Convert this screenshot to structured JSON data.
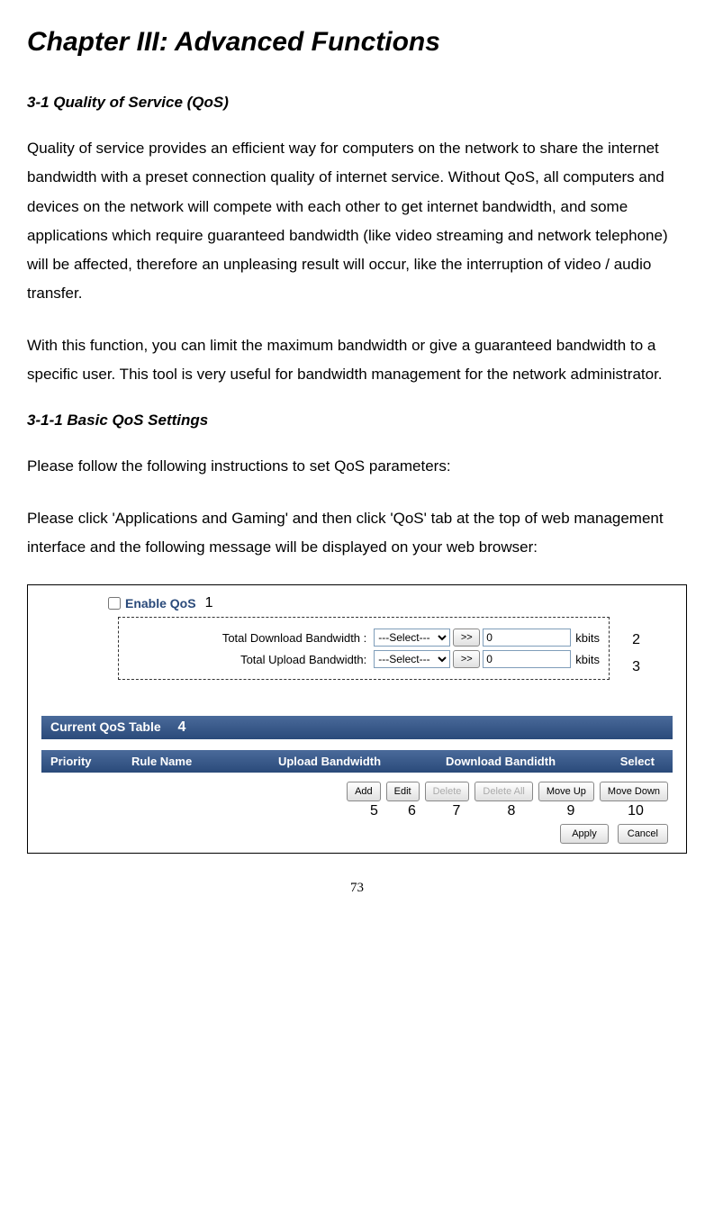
{
  "page": {
    "chapterTitle": "Chapter III: Advanced Functions",
    "section1": "3-1 Quality of Service (QoS)",
    "para1": "Quality of service provides an efficient way for computers on the network to share the internet bandwidth with a preset connection quality of internet service. Without QoS, all computers and devices on the network will compete with each other to get internet bandwidth, and some applications which require guaranteed bandwidth (like video streaming and network telephone) will be affected, therefore an unpleasing result will occur, like the interruption of video / audio transfer.",
    "para2": "With this function, you can limit the maximum bandwidth or give a guaranteed bandwidth to a specific user.    This tool is very useful for bandwidth management for the network administrator.",
    "section1_1": "3-1-1 Basic QoS Settings",
    "para3": "Please follow the following instructions to set QoS parameters:",
    "para4": "Please click 'Applications and Gaming' and then click 'QoS' tab at the top of web management interface and the following message will be displayed on your web browser:",
    "pageNumber": "73"
  },
  "qos": {
    "enableLabel": "Enable QoS",
    "callout1": "1",
    "downloadLabel": "Total Download Bandwidth :",
    "uploadLabel": "Total Upload Bandwidth:",
    "selectPlaceholder": "---Select---",
    "arrowLabel": ">>",
    "bwValue": "0",
    "kbits": "kbits",
    "callout2": "2",
    "callout3": "3",
    "tableTitle": "Current QoS Table",
    "callout4": "4",
    "cols": {
      "priority": "Priority",
      "ruleName": "Rule Name",
      "upload": "Upload Bandwidth",
      "download": "Download Bandidth",
      "select": "Select"
    },
    "buttons": {
      "add": "Add",
      "edit": "Edit",
      "delete": "Delete",
      "deleteAll": "Delete All",
      "moveUp": "Move Up",
      "moveDown": "Move Down",
      "apply": "Apply",
      "cancel": "Cancel"
    },
    "callouts": {
      "c5": "5",
      "c6": "6",
      "c7": "7",
      "c8": "8",
      "c9": "9",
      "c10": "10"
    }
  }
}
